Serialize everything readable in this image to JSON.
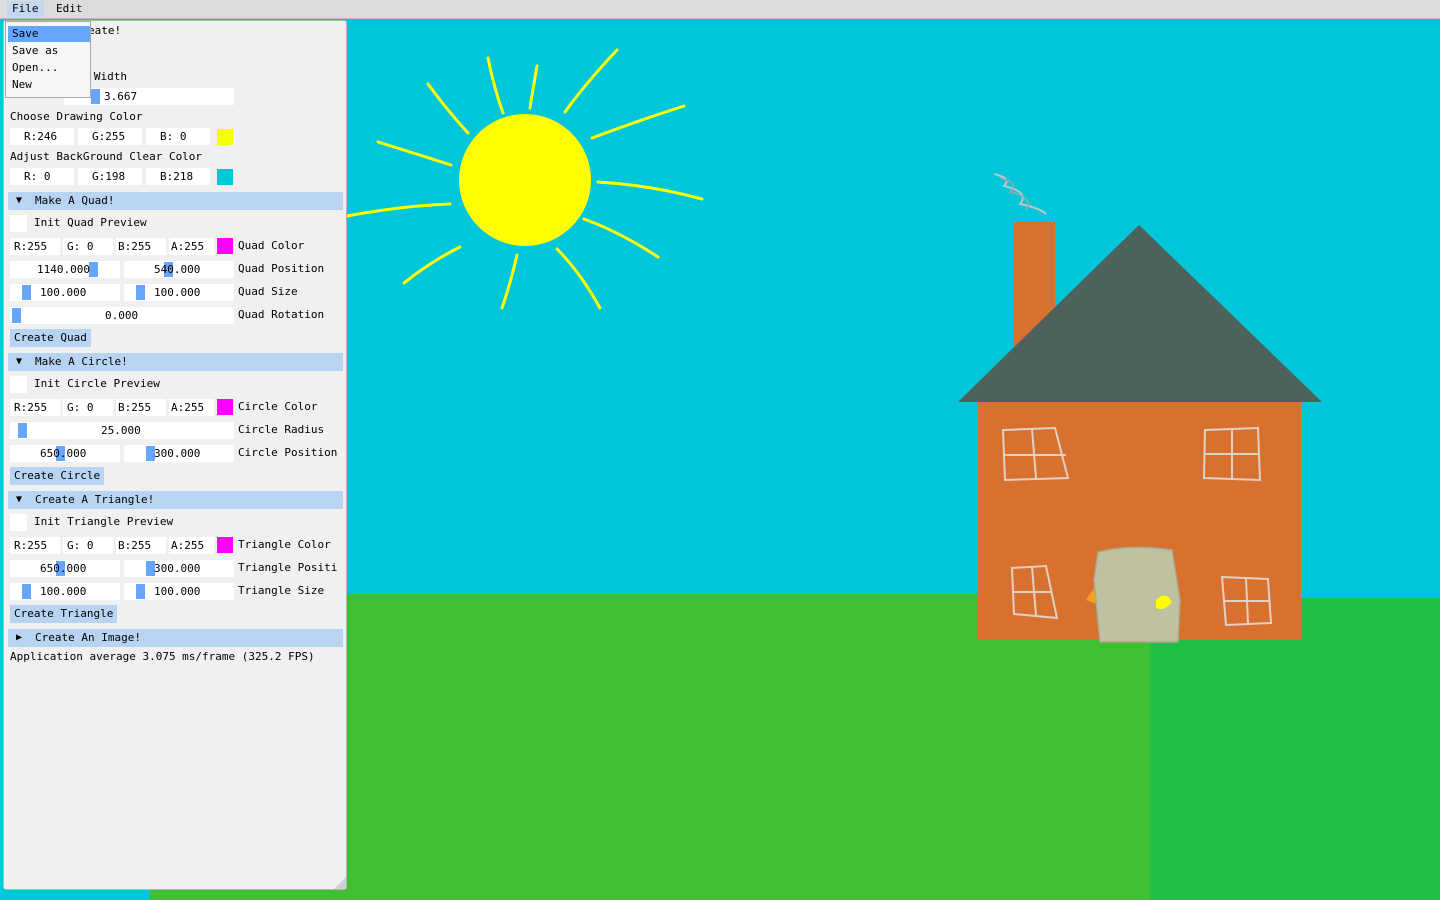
{
  "menu": {
    "file": "File",
    "edit": "Edit"
  },
  "file_menu": {
    "items": [
      "Save",
      "Save as",
      "Open...",
      "New"
    ]
  },
  "panel": {
    "title_suffix": "eate!",
    "line_width_label_suffix": "ng Width",
    "line_width_value": "3.667",
    "choose_color_label": "Choose Drawing Color",
    "draw_color": {
      "r": "R:246",
      "g": "G:255",
      "b": "B:  0",
      "swatch": "#f6ff00"
    },
    "bg_color_label": "Adjust BackGround Clear Color",
    "bg_color": {
      "r": "R:  0",
      "g": "G:198",
      "b": "B:218",
      "swatch": "#00c6da"
    },
    "quad": {
      "header": "Make A Quad!",
      "preview": "Init Quad Preview",
      "r": "R:255",
      "g": "G:  0",
      "b": "B:255",
      "a": "A:255",
      "color_label": "Quad Color",
      "swatch": "#ff00ff",
      "pos_x": "1140.000",
      "pos_y": "540.000",
      "pos_label": "Quad Position",
      "size_w": "100.000",
      "size_h": "100.000",
      "size_label": "Quad Size",
      "rotation": "0.000",
      "rotation_label": "Quad Rotation",
      "create": "Create Quad"
    },
    "circle": {
      "header": "Make A Circle!",
      "preview": "Init Circle Preview",
      "r": "R:255",
      "g": "G:  0",
      "b": "B:255",
      "a": "A:255",
      "color_label": "Circle Color",
      "swatch": "#ff00ff",
      "radius": "25.000",
      "radius_label": "Circle Radius",
      "pos_x": "650.000",
      "pos_y": "300.000",
      "pos_label": "Circle Position",
      "create": "Create Circle"
    },
    "triangle": {
      "header": "Create A Triangle!",
      "preview": "Init Triangle Preview",
      "r": "R:255",
      "g": "G:  0",
      "b": "B:255",
      "a": "A:255",
      "color_label": "Triangle Color",
      "swatch": "#ff00ff",
      "pos_x": "650.000",
      "pos_y": "300.000",
      "pos_label": "Triangle Positi",
      "size_w": "100.000",
      "size_h": "100.000",
      "size_label": "Triangle Size",
      "create": "Create Triangle"
    },
    "image": {
      "header": "Create An Image!"
    },
    "fps_text": "Application average 3.075 ms/frame (325.2 FPS)"
  },
  "colors": {
    "sky": "#00c6da",
    "grass": "#3fbf32",
    "sun": "#ffff00",
    "house_wall": "#d8702f",
    "roof": "#4e625c",
    "door": "#c0c1a0",
    "accent": "#66a6ff",
    "header_bg": "#b8d4f3"
  }
}
